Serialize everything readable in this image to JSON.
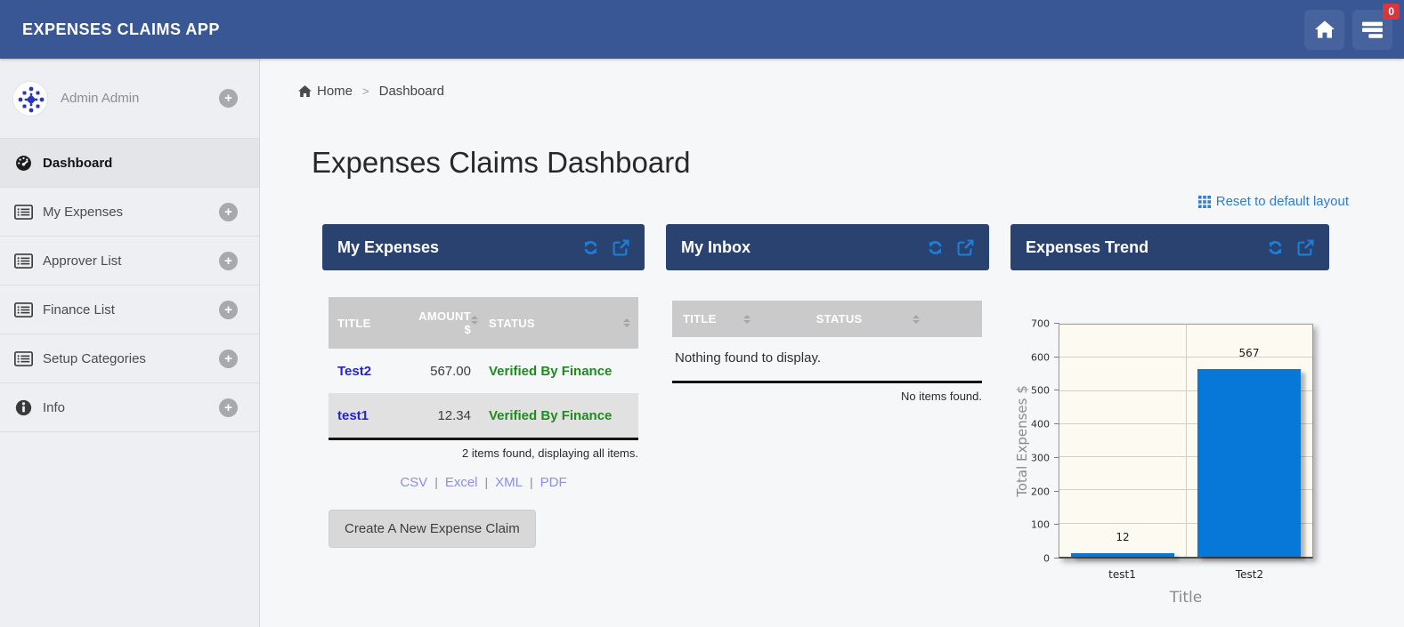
{
  "colors": {
    "topbar_blue": "#3a5795",
    "panel_header_navy": "#2a4270",
    "accent_icon_blue": "#1b7fd9",
    "reset_link_blue": "#2e7cd6",
    "row_link_blue": "#2525c8",
    "status_green": "#1f8a1f",
    "export_lavender": "#8d8fe0",
    "chart_bar_blue": "#0878d8",
    "badge_red": "#d9363e"
  },
  "app": {
    "title": "EXPENSES CLAIMS APP"
  },
  "topbar": {
    "badge_count": "0"
  },
  "icons": {
    "plus": "+"
  },
  "sidebar": {
    "user": {
      "name": "Admin Admin"
    },
    "items": [
      {
        "label": "Dashboard"
      },
      {
        "label": "My Expenses"
      },
      {
        "label": "Approver List"
      },
      {
        "label": "Finance List"
      },
      {
        "label": "Setup Categories"
      },
      {
        "label": "Info"
      }
    ]
  },
  "breadcrumb": {
    "home": "Home",
    "separator": ">",
    "current": "Dashboard"
  },
  "main": {
    "page_title": "Expenses Claims Dashboard",
    "reset_link_label": "Reset to default layout"
  },
  "my_expenses": {
    "title": "My Expenses",
    "headers": {
      "title": "TITLE",
      "amount": "AMOUNT $",
      "status": "STATUS"
    },
    "rows": [
      {
        "title": "Test2",
        "amount": "567.00",
        "status": "Verified By Finance"
      },
      {
        "title": "test1",
        "amount": "12.34",
        "status": "Verified By Finance"
      }
    ],
    "footer": "2 items found, displaying all items.",
    "export_separator": "|",
    "export_links": [
      "CSV",
      "Excel",
      "XML",
      "PDF"
    ],
    "create_button_label": "Create A New Expense Claim"
  },
  "my_inbox": {
    "title": "My Inbox",
    "headers": {
      "title": "TITLE",
      "status": "STATUS"
    },
    "empty_message": "Nothing found to display.",
    "footer": "No items found."
  },
  "expenses_trend": {
    "title": "Expenses Trend"
  },
  "chart_data": {
    "type": "bar",
    "categories": [
      "test1",
      "Test2"
    ],
    "values": [
      12,
      567
    ],
    "value_labels": [
      "12",
      "567"
    ],
    "title": "",
    "xlabel": "Title",
    "ylabel": "Total Expenses $",
    "ylim": [
      0,
      700
    ],
    "ytick_step": 100,
    "grid": true,
    "legend": false,
    "bar_color": "#0878d8",
    "plot_bg": "#fdfaf1"
  }
}
